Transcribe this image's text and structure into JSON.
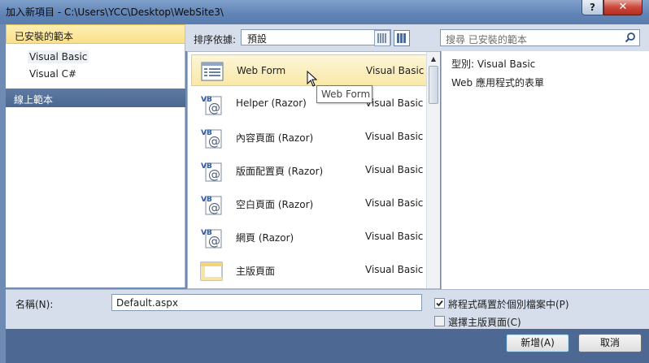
{
  "window": {
    "title": "加入新項目 - C:\\Users\\YCC\\Desktop\\WebSite3\\",
    "help_label": "?",
    "close_label": "✕"
  },
  "left_pane": {
    "installed_header": "已安裝的範本",
    "languages": [
      {
        "label": "Visual Basic",
        "selected": true
      },
      {
        "label": "Visual C#",
        "selected": false
      }
    ],
    "online_header": "線上範本"
  },
  "toolbar": {
    "sort_label": "排序依據:",
    "sort_value": "預設",
    "search_placeholder": "搜尋 已安裝的範本"
  },
  "templates": [
    {
      "name": "Web Form",
      "language": "Visual Basic",
      "icon": "webform-icon",
      "selected": true
    },
    {
      "name": "Helper (Razor)",
      "language": "Visual Basic",
      "icon": "vb-razor-icon",
      "selected": false
    },
    {
      "name": "內容頁面 (Razor)",
      "language": "Visual Basic",
      "icon": "vb-razor-icon",
      "selected": false
    },
    {
      "name": "版面配置頁 (Razor)",
      "language": "Visual Basic",
      "icon": "vb-razor-icon",
      "selected": false
    },
    {
      "name": "空白頁面 (Razor)",
      "language": "Visual Basic",
      "icon": "vb-razor-icon",
      "selected": false
    },
    {
      "name": "網頁 (Razor)",
      "language": "Visual Basic",
      "icon": "vb-razor-icon",
      "selected": false
    },
    {
      "name": "主版頁面",
      "language": "Visual Basic",
      "icon": "masterpage-icon",
      "selected": false
    }
  ],
  "tooltip": "Web Form",
  "details": {
    "type_line": "型別:  Visual Basic",
    "description": "Web 應用程式的表單"
  },
  "bottom": {
    "name_label": "名稱(N):",
    "name_value": "Default.aspx",
    "option1_label": "將程式碼置於個別檔案中(P)",
    "option1_checked": true,
    "option2_label": "選擇主版頁面(C)",
    "option2_checked": false
  },
  "buttons": {
    "add": "新增(A)",
    "cancel": "取消"
  }
}
